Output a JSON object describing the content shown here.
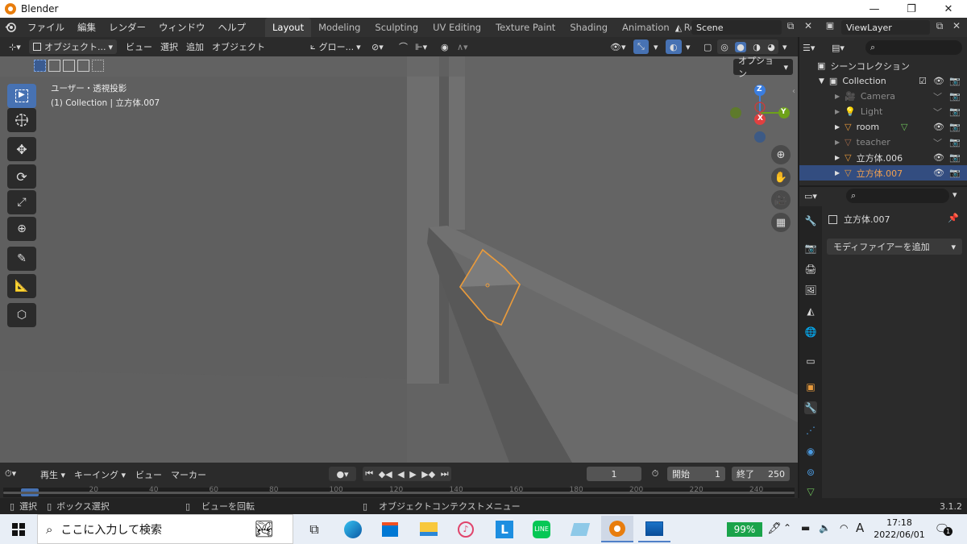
{
  "window": {
    "title": "Blender",
    "min": "—",
    "max": "❐",
    "close": "✕"
  },
  "menus": [
    "ファイル",
    "編集",
    "レンダー",
    "ウィンドウ",
    "ヘルプ"
  ],
  "workspaces": [
    "Layout",
    "Modeling",
    "Sculpting",
    "UV Editing",
    "Texture Paint",
    "Shading",
    "Animation",
    "Rendering"
  ],
  "active_workspace": "Layout",
  "scene": {
    "label": "Scene",
    "viewlayer": "ViewLayer"
  },
  "viewport_header": {
    "mode": "オブジェクト...",
    "view": "ビュー",
    "select": "選択",
    "add": "追加",
    "object": "オブジェクト",
    "orientation": "グロー...",
    "options": "オプション"
  },
  "viewport_overlay": {
    "projection": "ユーザー・透視投影",
    "collection_info": "(1) Collection | 立方体.007"
  },
  "gizmo": {
    "z": "Z",
    "x": "X",
    "y": "Y"
  },
  "outliner": {
    "scene_collection": "シーンコレクション",
    "rows": [
      {
        "name": "Collection",
        "type": "collection"
      },
      {
        "name": "Camera",
        "type": "camera"
      },
      {
        "name": "Light",
        "type": "light"
      },
      {
        "name": "room",
        "type": "mesh"
      },
      {
        "name": "teacher",
        "type": "mesh"
      },
      {
        "name": "立方体.006",
        "type": "mesh"
      },
      {
        "name": "立方体.007",
        "type": "mesh"
      }
    ]
  },
  "properties": {
    "object_name": "立方体.007",
    "add_modifier": "モディファイアーを追加"
  },
  "timeline": {
    "playback": "再生",
    "keying": "キーイング",
    "view": "ビュー",
    "marker": "マーカー",
    "current_frame": "1",
    "start_label": "開始",
    "start": "1",
    "end_label": "終了",
    "end": "250",
    "ticks": [
      "1",
      "20",
      "40",
      "60",
      "80",
      "100",
      "120",
      "140",
      "160",
      "180",
      "200",
      "220",
      "240"
    ]
  },
  "statusbar": {
    "select": "選択",
    "box_select": "ボックス選択",
    "rotate_view": "ビューを回転",
    "context_menu": "オブジェクトコンテクストメニュー",
    "version": "3.1.2"
  },
  "taskbar": {
    "search_placeholder": "ここに入力して検索",
    "battery": "99%",
    "ime": "A",
    "time": "17:18",
    "date": "2022/06/01",
    "notifications": "1"
  },
  "colors": {
    "accent": "#4772b3",
    "selection": "#e89a3c",
    "outliner_sel": "#334d80"
  }
}
